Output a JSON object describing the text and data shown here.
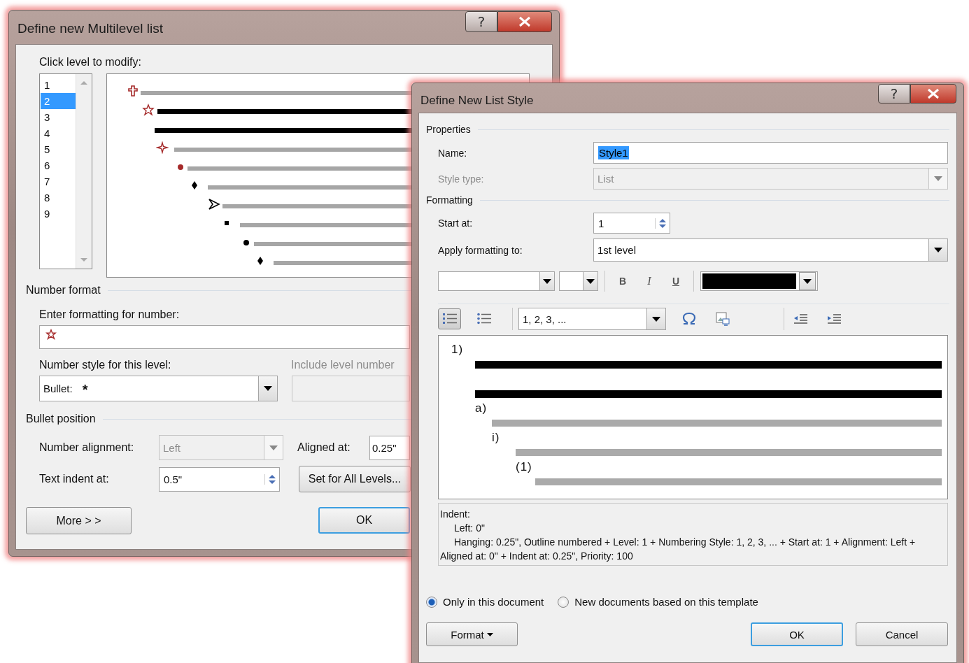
{
  "multilevel_dialog": {
    "title": "Define new Multilevel list",
    "help_button": "?",
    "level_prompt": "Click level to modify:",
    "levels": [
      {
        "label": "1",
        "selected": false
      },
      {
        "label": "2",
        "selected": true
      },
      {
        "label": "3",
        "selected": false
      },
      {
        "label": "4",
        "selected": false
      },
      {
        "label": "5",
        "selected": false
      },
      {
        "label": "6",
        "selected": false
      },
      {
        "label": "7",
        "selected": false
      },
      {
        "label": "8",
        "selected": false
      },
      {
        "label": "9",
        "selected": false
      }
    ],
    "preview_rows": [
      {
        "kind": "cross",
        "current": false
      },
      {
        "kind": "star",
        "current": true
      },
      {
        "kind": "none",
        "current": true
      },
      {
        "kind": "sparkle",
        "current": false
      },
      {
        "kind": "circle",
        "current": false
      },
      {
        "kind": "diamond",
        "current": false
      },
      {
        "kind": "arrowhead",
        "current": false
      },
      {
        "kind": "square",
        "current": false
      },
      {
        "kind": "disc",
        "current": false
      },
      {
        "kind": "diamond",
        "current": false
      }
    ],
    "number_format_heading": "Number format",
    "format_label": "Enter formatting for number:",
    "style_label": "Number style for this level:",
    "style_value": "Bullet:",
    "style_symbol": "*",
    "include_label": "Include level number",
    "position_heading": "Bullet position",
    "alignment_label": "Number alignment:",
    "alignment_value": "Left",
    "alignment_disabled": true,
    "aligned_at_label": "Aligned at:",
    "aligned_at_value": "0.25\"",
    "indent_label": "Text indent at:",
    "indent_value": "0.5\"",
    "set_all_button": "Set for All Levels...",
    "more_button": "More > >",
    "ok_button": "OK"
  },
  "list_style_dialog": {
    "title": "Define New List Style",
    "help_button": "?",
    "properties_heading": "Properties",
    "name_label": "Name:",
    "name_value": "Style1",
    "style_type_label": "Style type:",
    "style_type_value": "List",
    "style_type_disabled": true,
    "formatting_heading": "Formatting",
    "start_label": "Start at:",
    "start_value": "1",
    "apply_label": "Apply formatting to:",
    "apply_value": "1st level",
    "font_buttons": [
      {
        "kind": "bold",
        "label": "B"
      },
      {
        "kind": "italic",
        "label": "I"
      },
      {
        "kind": "underline",
        "label": "U"
      }
    ],
    "list_type_buttons": [
      {
        "kind": "numbered",
        "selected": true
      },
      {
        "kind": "bulleted",
        "selected": false
      }
    ],
    "number_style_value": "1, 2, 3, ...",
    "preview_rows": [
      {
        "label": "1)",
        "current": true
      },
      {
        "label": "",
        "current": true
      },
      {
        "label": "a)",
        "current": false
      },
      {
        "label": "i)",
        "current": false
      },
      {
        "label": "(1)",
        "current": false
      }
    ],
    "description_heading": "Indent:",
    "description_lines": [
      "Left:  0\"",
      "Hanging:  0.25\", Outline numbered + Level: 1 + Numbering Style: 1, 2, 3, ... + Start at: 1 + Alignment: Left + Aligned at:  0\" + Indent at:  0.25\", Priority: 100"
    ],
    "radios": [
      {
        "label": "Only in this document",
        "selected": true
      },
      {
        "label": "New documents based on this template",
        "selected": false
      }
    ],
    "format_button": "Format",
    "ok_button": "OK",
    "cancel_button": "Cancel"
  }
}
